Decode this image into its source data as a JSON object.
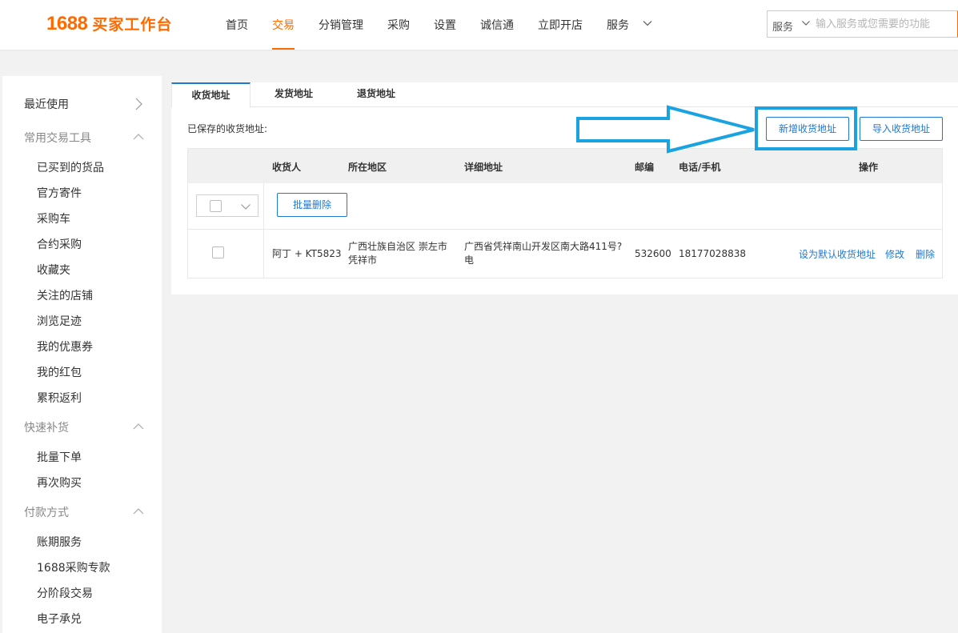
{
  "header": {
    "logo_number": "1688",
    "logo_text": "买家工作台",
    "nav": [
      "首页",
      "交易",
      "分销管理",
      "采购",
      "设置",
      "诚信通",
      "立即开店",
      "服务"
    ],
    "active_nav": "交易",
    "search": {
      "scope": "服务",
      "placeholder": "输入服务或您需要的功能"
    },
    "accent_color": "#ff6a00"
  },
  "sidebar": {
    "recent": "最近使用",
    "groups": [
      {
        "title": "常用交易工具",
        "items": [
          "已买到的货品",
          "官方寄件",
          "采购车",
          "合约采购",
          "收藏夹",
          "关注的店铺",
          "浏览足迹",
          "我的优惠券",
          "我的红包",
          "累积返利"
        ]
      },
      {
        "title": "快速补货",
        "items": [
          "批量下单",
          "再次购买"
        ]
      },
      {
        "title": "付款方式",
        "items": [
          "账期服务",
          "1688采购专款",
          "分阶段交易",
          "电子承兑"
        ]
      }
    ]
  },
  "main": {
    "tabs": [
      "收货地址",
      "发货地址",
      "退货地址"
    ],
    "active_tab": "收货地址",
    "saved_label": "已保存的收货地址:",
    "buttons": {
      "new_address": "新增收货地址",
      "import_address": "导入收货地址",
      "batch_delete": "批量删除"
    },
    "table": {
      "headers": [
        "收货人",
        "所在地区",
        "详细地址",
        "邮编",
        "电话/手机",
        "操作"
      ],
      "rows": [
        {
          "recipient": "阿丁 + KT5823",
          "region_line1": "广西壮族自治区 崇左市",
          "region_line2": "凭祥市",
          "address_line1": "广西省凭祥南山开发区南大路411号?",
          "address_line2": "电",
          "postcode": "532600",
          "phone": "18177028838",
          "actions": [
            "设为默认收货地址",
            "修改",
            "删除"
          ]
        }
      ]
    },
    "link_color": "#1e78d7"
  },
  "annotation": {
    "color": "#1aa3e0"
  }
}
